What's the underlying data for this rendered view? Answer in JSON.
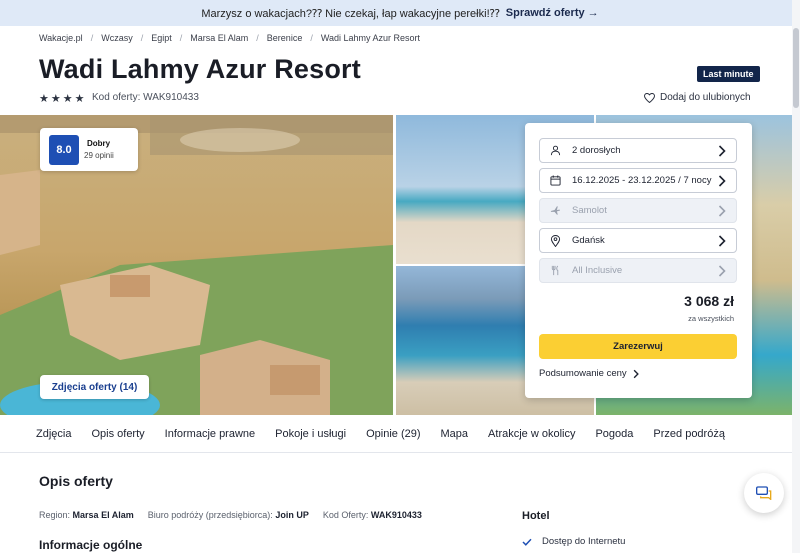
{
  "promo": {
    "text": "Marzysz o wakacjach?⁇ Nie czekaj, łap wakacyjne perełki!⁇",
    "cta": "Sprawdź oferty →"
  },
  "breadcrumb": [
    "Wakacje.pl",
    "Wczasy",
    "Egipt",
    "Marsa El Alam",
    "Berenice",
    "Wadi Lahmy Azur Resort"
  ],
  "hotel": {
    "name": "Wadi Lahmy Azur Resort",
    "badge": "Last minute",
    "stars": 4,
    "code_label": "Kod oferty: WAK910433",
    "favorite_label": "Dodaj do ulubionych"
  },
  "rating": {
    "score": "8.0",
    "label": "Dobry",
    "count": "29 opinii"
  },
  "gallery": {
    "photos_button": "Zdjęcia oferty (14)"
  },
  "booking": {
    "travelers": "2 dorosłych",
    "dates": "16.12.2025 - 23.12.2025 / 7 nocy",
    "transport": "Samolot",
    "departure": "Gdańsk",
    "board": "All Inclusive",
    "price": "3 068 zł",
    "price_note": "za wszystkich",
    "reserve_label": "Zarezerwuj",
    "summary_label": "Podsumowanie ceny"
  },
  "tabs": [
    "Zdjęcia",
    "Opis oferty",
    "Informacje prawne",
    "Pokoje i usługi",
    "Opinie (29)",
    "Mapa",
    "Atrakcje w okolicy",
    "Pogoda",
    "Przed podróżą"
  ],
  "offer": {
    "title": "Opis oferty",
    "region_label": "Region:",
    "region": "Marsa El Alam",
    "agency_label": "Biuro podróży (przedsiębiorca):",
    "agency": "Join UP",
    "code_label": "Kod Oferty:",
    "code": "WAK910433",
    "general_title": "Informacje ogólne"
  },
  "hotel_section": {
    "title": "Hotel",
    "amenity": "Dostęp do Internetu"
  },
  "colors": {
    "accent": "#fbcf33",
    "brand": "#12254a",
    "rating": "#1e4fb4"
  }
}
